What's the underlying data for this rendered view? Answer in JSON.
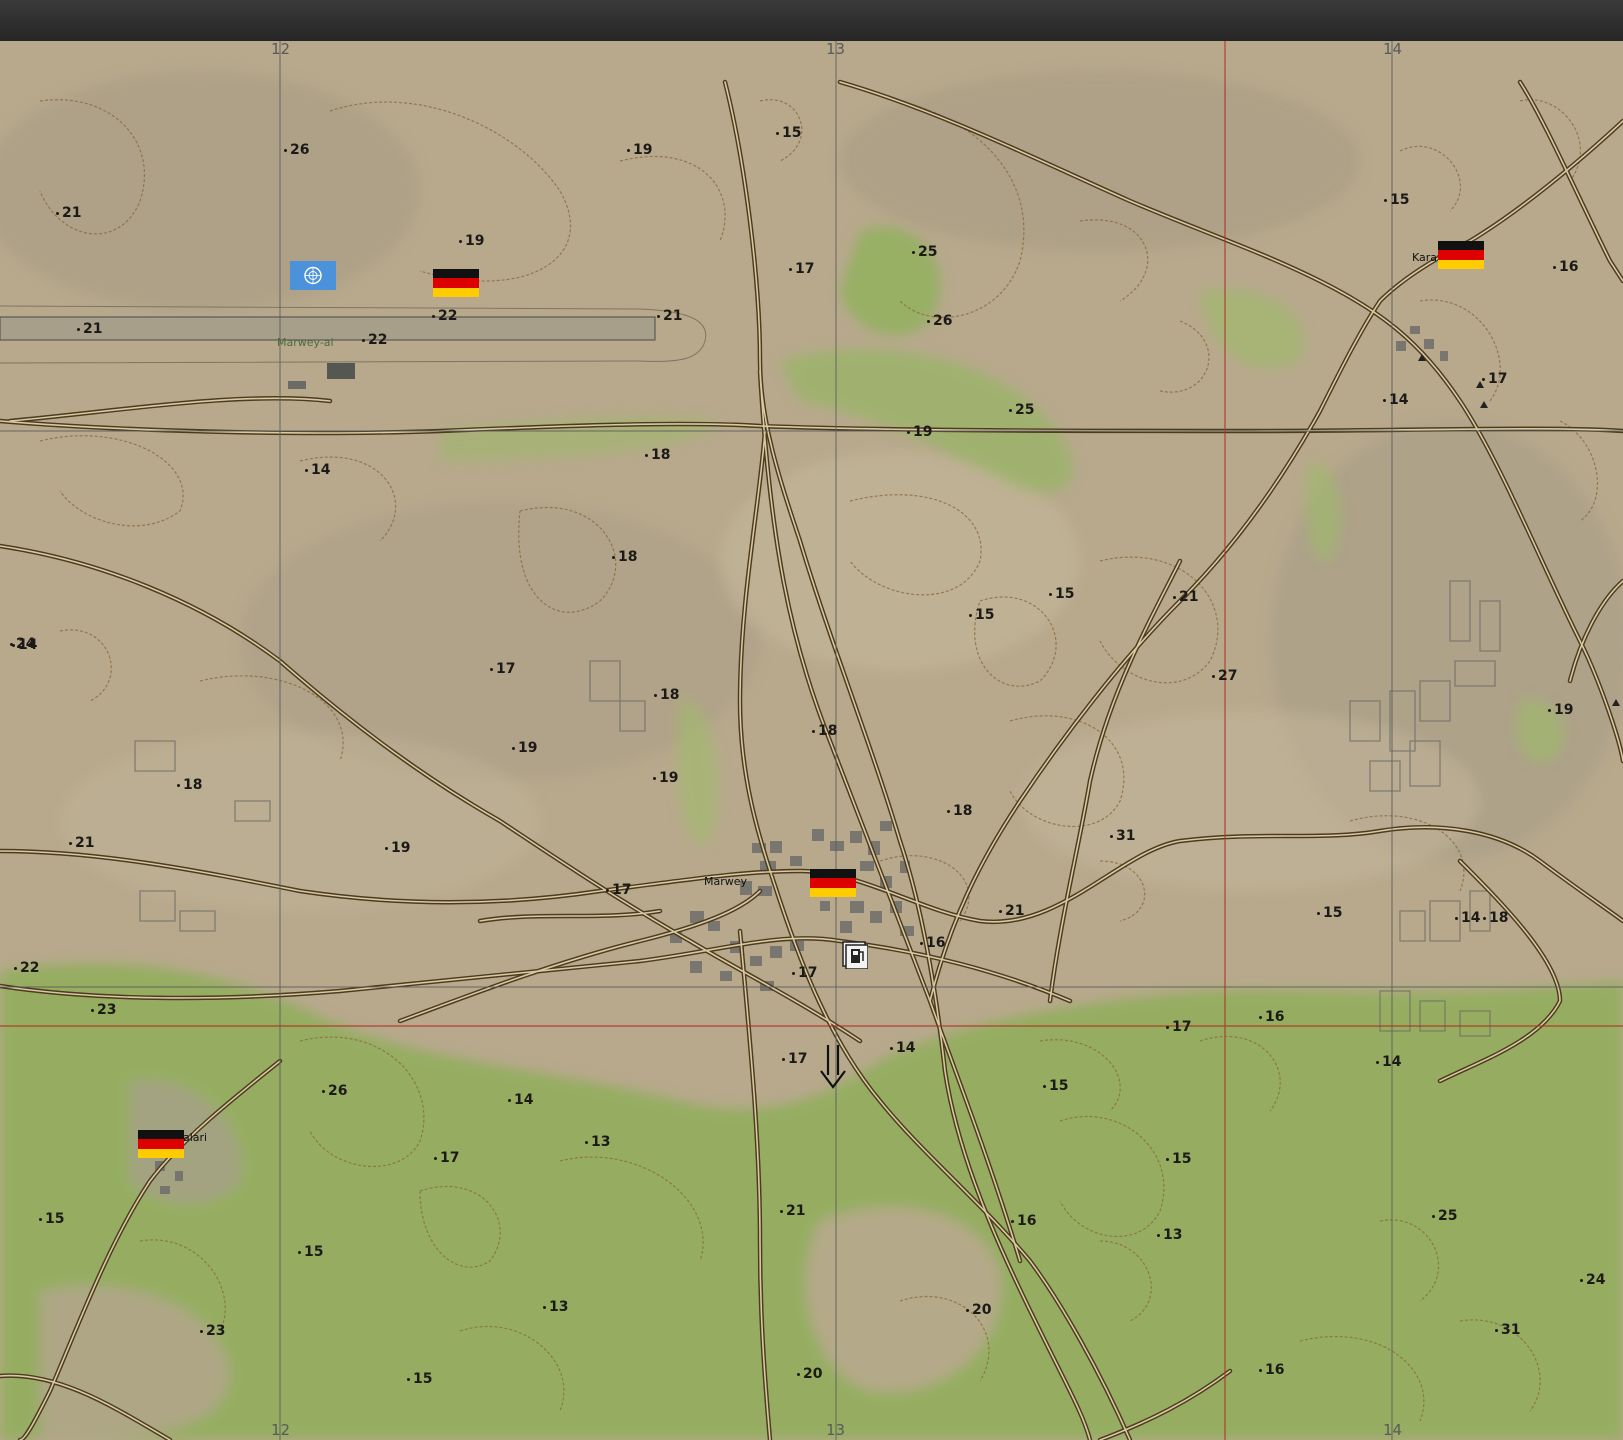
{
  "grid_labels": {
    "top": [
      "12",
      "13",
      "14"
    ],
    "bottom": [
      "12",
      "13",
      "14"
    ]
  },
  "places": {
    "marwey": "Marwey",
    "karay": "Karay",
    "alari": "alari",
    "airfield": "Marwey-ai"
  },
  "elevations": [
    "26",
    "19",
    "15",
    "21",
    "19",
    "15",
    "17",
    "25",
    "16",
    "21",
    "22",
    "21",
    "26",
    "22",
    "14",
    "17",
    "14",
    "19",
    "25",
    "18",
    "18",
    "14",
    "15",
    "21",
    "24",
    "27",
    "15",
    "17",
    "18",
    "18",
    "19",
    "19",
    "18",
    "19",
    "18",
    "18",
    "21",
    "31",
    "19",
    "17",
    "21",
    "15",
    "14",
    "16",
    "22",
    "17",
    "23",
    "17",
    "16",
    "14",
    "17",
    "14",
    "26",
    "14",
    "15",
    "13",
    "17",
    "15",
    "15",
    "21",
    "15",
    "16",
    "13",
    "25",
    "13",
    "24",
    "23",
    "20",
    "31",
    "15",
    "20",
    "16"
  ],
  "markers": {
    "fuel": "fuel-station",
    "arrow": "down-arrow"
  },
  "colors": {
    "terrain": "#b9aa8e",
    "vegetation": "#8fae5a",
    "road": "#4b3b20",
    "contour": "#8a6a3e",
    "grid": "#5c5c5a",
    "grid_red": "#b03020"
  }
}
